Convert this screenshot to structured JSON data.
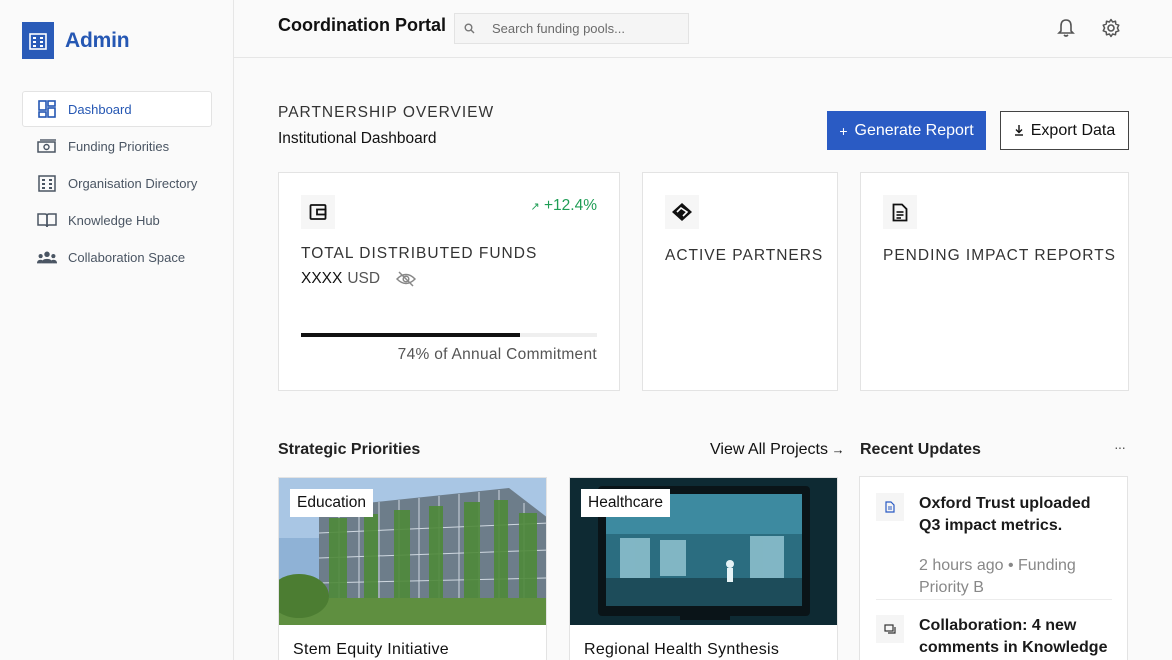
{
  "sidebar": {
    "brand": "Admin",
    "items": [
      {
        "label": "Dashboard",
        "icon": "dashboard-icon",
        "active": true
      },
      {
        "label": "Funding Priorities",
        "icon": "money-icon"
      },
      {
        "label": "Organisation Directory",
        "icon": "building-icon"
      },
      {
        "label": "Knowledge Hub",
        "icon": "book-icon"
      },
      {
        "label": "Collaboration Space",
        "icon": "people-icon"
      }
    ]
  },
  "topbar": {
    "title": "Coordination Portal",
    "search_placeholder": "Search funding pools...",
    "icons": [
      "bell-icon",
      "gear-icon"
    ]
  },
  "header": {
    "overline": "PARTNERSHIP OVERVIEW",
    "subtitle": "Institutional Dashboard",
    "generate_label": "Generate Report",
    "export_label": "Export Data"
  },
  "stats": {
    "funds": {
      "label": "TOTAL DISTRIBUTED FUNDS",
      "value": "XXXX",
      "unit": "USD",
      "trend": "+12.4%",
      "progress_percent": 74,
      "progress_caption": "74% of Annual Commitment",
      "icon": "wallet-icon"
    },
    "partners": {
      "label": "ACTIVE PARTNERS",
      "icon": "handshake-icon"
    },
    "reports": {
      "label": "PENDING IMPACT REPORTS",
      "icon": "document-icon"
    }
  },
  "priorities": {
    "heading": "Strategic Priorities",
    "view_all": "View All Projects",
    "projects": [
      {
        "tag": "Education",
        "name": "Stem Equity Initiative"
      },
      {
        "tag": "Healthcare",
        "name": "Regional Health Synthesis"
      }
    ]
  },
  "updates": {
    "heading": "Recent Updates",
    "more": "···",
    "items": [
      {
        "title": "Oxford Trust uploaded Q3 impact metrics.",
        "meta": "2 hours ago • Funding Priority B",
        "icon": "file-icon"
      },
      {
        "title": "Collaboration: 4 new comments in Knowledge",
        "meta": "",
        "icon": "comment-icon"
      }
    ]
  },
  "colors": {
    "accent": "#2a5bc4",
    "trend_up": "#1f9d55"
  }
}
